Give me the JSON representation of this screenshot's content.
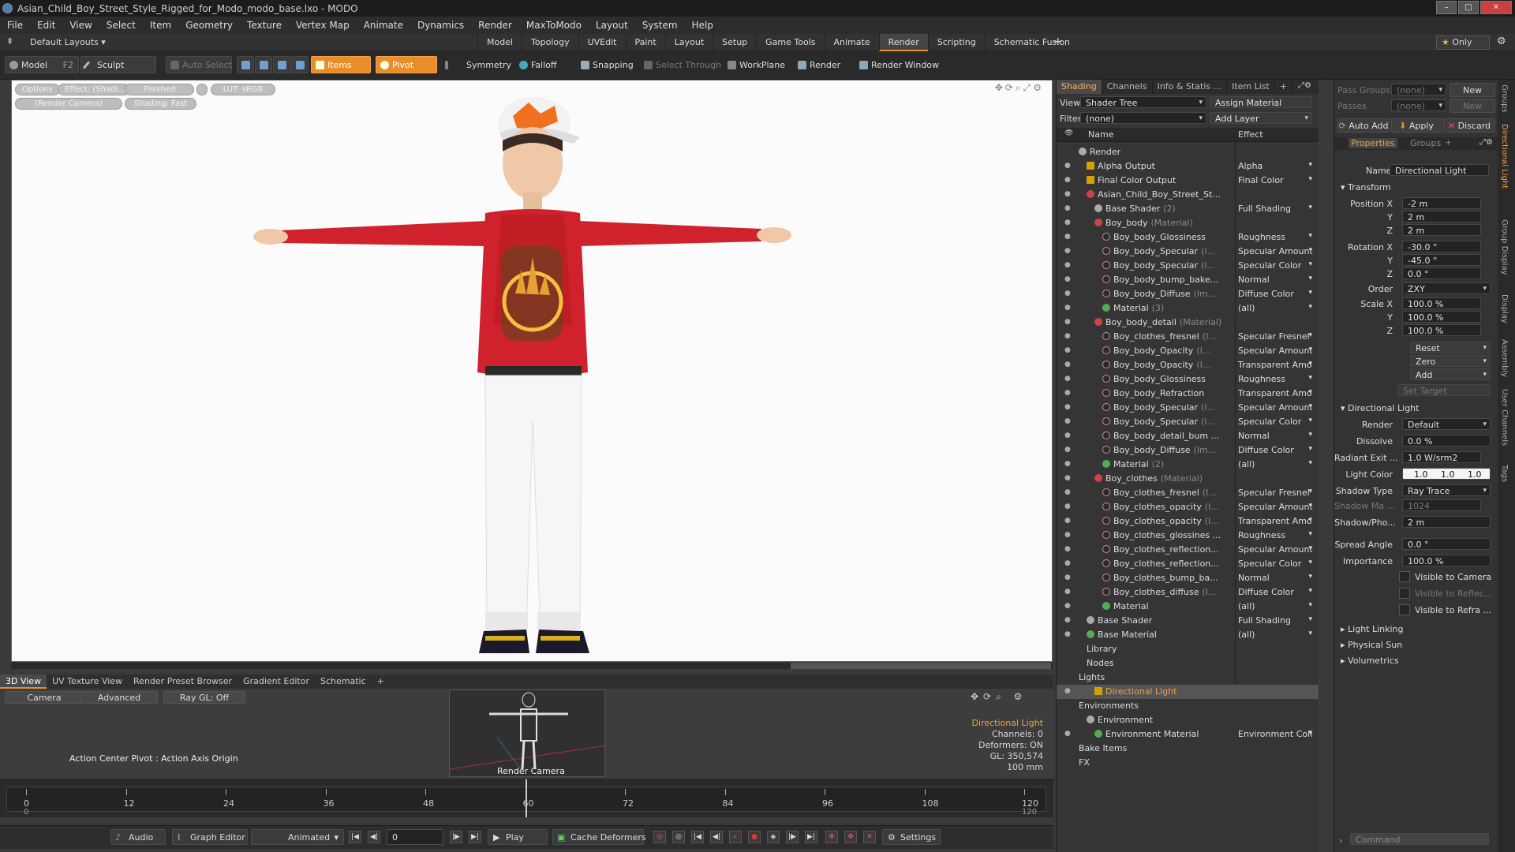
{
  "window": {
    "title": "Asian_Child_Boy_Street_Style_Rigged_for_Modo_modo_base.lxo - MODO"
  },
  "menu": [
    "File",
    "Edit",
    "View",
    "Select",
    "Item",
    "Geometry",
    "Texture",
    "Vertex Map",
    "Animate",
    "Dynamics",
    "Render",
    "MaxToModo",
    "Layout",
    "System",
    "Help"
  ],
  "layout": {
    "preset": "Default Layouts ▾",
    "tabs": [
      "Model",
      "Topology",
      "UVEdit",
      "Paint",
      "Layout",
      "Setup",
      "Game Tools",
      "Animate",
      "Render",
      "Scripting",
      "Schematic Fusion"
    ],
    "active_tab": "Render",
    "add": "+",
    "only": "Only"
  },
  "toolbar": {
    "model": "Model",
    "f2": "F2",
    "sculpt": "Sculpt",
    "auto_select": "Auto Select",
    "items": "Items",
    "pivot": "Pivot",
    "symmetry": "Symmetry",
    "falloff": "Falloff",
    "snapping": "Snapping",
    "select_through": "Select Through",
    "workplane": "WorkPlane",
    "render": "Render",
    "render_window": "Render Window"
  },
  "viewport": {
    "options": "Options",
    "effect": "Effect: (Shadi...",
    "finished": "Finished",
    "lut": "LUT: sRGB",
    "camera": "(Render Camera)",
    "shading": "Shading: Fast"
  },
  "bottom": {
    "tabs": [
      "3D View",
      "UV Texture View",
      "Render Preset Browser",
      "Gradient Editor",
      "Schematic"
    ],
    "active_tab": "3D View",
    "add": "+",
    "camera": "Camera",
    "advanced": "Advanced",
    "raygl": "Ray GL: Off",
    "action_center": "Action Center Pivot : Action Axis Origin",
    "render_camera": "Render Camera",
    "info": [
      "Directional Light",
      "Channels: 0",
      "Deformers: ON",
      "GL: 350,574",
      "100 mm"
    ]
  },
  "timeline": {
    "ticks": [
      "0",
      "12",
      "24",
      "36",
      "48",
      "60",
      "72",
      "84",
      "96",
      "108",
      "120"
    ],
    "sub_ticks": [
      "0",
      "120"
    ]
  },
  "transport": {
    "audio": "Audio",
    "graph_editor": "Graph Editor",
    "animated": "Animated",
    "frame": "0",
    "play": "Play",
    "cache_deformers": "Cache Deformers",
    "settings": "Settings"
  },
  "shading": {
    "tabs": [
      "Shading",
      "Channels",
      "Info & Statis ...",
      "Item List",
      "+"
    ],
    "active_tab": "Shading",
    "view_label": "View",
    "view_value": "Shader Tree",
    "assign": "Assign Material",
    "filter_label": "Filter",
    "filter_value": "(none)",
    "add_layer": "Add Layer",
    "col_name": "Name",
    "col_effect": "Effect",
    "rows": [
      {
        "name": "Render",
        "effect": "",
        "indent": 0,
        "type": "shader",
        "eye": false
      },
      {
        "name": "Alpha Output",
        "effect": "Alpha",
        "indent": 1,
        "type": "out",
        "eye": true
      },
      {
        "name": "Final Color Output",
        "effect": "Final Color",
        "indent": 1,
        "type": "out",
        "eye": true
      },
      {
        "name": "Asian_Child_Boy_Street_St...",
        "effect": "",
        "indent": 1,
        "type": "mat",
        "eye": true
      },
      {
        "name": "Base Shader",
        "sub": "(2)",
        "effect": "Full Shading",
        "indent": 2,
        "type": "shader",
        "eye": true
      },
      {
        "name": "Boy_body",
        "sub": "(Material)",
        "effect": "",
        "indent": 2,
        "type": "mat",
        "eye": true
      },
      {
        "name": "Boy_body_Glossiness",
        "effect": "Roughness",
        "indent": 3,
        "type": "tex",
        "eye": true
      },
      {
        "name": "Boy_body_Specular",
        "sub": "(I...",
        "effect": "Specular Amount",
        "indent": 3,
        "type": "tex",
        "eye": true
      },
      {
        "name": "Boy_body_Specular",
        "sub": "(I...",
        "effect": "Specular Color",
        "indent": 3,
        "type": "tex",
        "eye": true
      },
      {
        "name": "Boy_body_bump_bake...",
        "effect": "Normal",
        "indent": 3,
        "type": "tex",
        "eye": true
      },
      {
        "name": "Boy_body_Diffuse",
        "sub": "(Im...",
        "effect": "Diffuse Color",
        "indent": 3,
        "type": "tex",
        "eye": true
      },
      {
        "name": "Material",
        "sub": "(3)",
        "effect": "(all)",
        "indent": 3,
        "type": "grn",
        "eye": true
      },
      {
        "name": "Boy_body_detail",
        "sub": "(Material)",
        "effect": "",
        "indent": 2,
        "type": "mat",
        "eye": true
      },
      {
        "name": "Boy_clothes_fresnel",
        "sub": "(I...",
        "effect": "Specular Fresnel",
        "indent": 3,
        "type": "tex",
        "eye": true
      },
      {
        "name": "Boy_body_Opacity",
        "sub": "(I...",
        "effect": "Specular Amount",
        "indent": 3,
        "type": "tex",
        "eye": true
      },
      {
        "name": "Boy_body_Opacity",
        "sub": "(I...",
        "effect": "Transparent Amo ...",
        "indent": 3,
        "type": "tex",
        "eye": true
      },
      {
        "name": "Boy_body_Glossiness",
        "effect": "Roughness",
        "indent": 3,
        "type": "tex",
        "eye": true
      },
      {
        "name": "Boy_body_Refraction",
        "effect": "Transparent Amo ...",
        "indent": 3,
        "type": "tex",
        "eye": true
      },
      {
        "name": "Boy_body_Specular",
        "sub": "(I...",
        "effect": "Specular Amount",
        "indent": 3,
        "type": "tex",
        "eye": true
      },
      {
        "name": "Boy_body_Specular",
        "sub": "(I...",
        "effect": "Specular Color",
        "indent": 3,
        "type": "tex",
        "eye": true
      },
      {
        "name": "Boy_body_detail_bum ...",
        "effect": "Normal",
        "indent": 3,
        "type": "tex",
        "eye": true
      },
      {
        "name": "Boy_body_Diffuse",
        "sub": "(Im...",
        "effect": "Diffuse Color",
        "indent": 3,
        "type": "tex",
        "eye": true
      },
      {
        "name": "Material",
        "sub": "(2)",
        "effect": "(all)",
        "indent": 3,
        "type": "grn",
        "eye": true
      },
      {
        "name": "Boy_clothes",
        "sub": "(Material)",
        "effect": "",
        "indent": 2,
        "type": "mat",
        "eye": true
      },
      {
        "name": "Boy_clothes_fresnel",
        "sub": "(I...",
        "effect": "Specular Fresnel",
        "indent": 3,
        "type": "tex",
        "eye": true
      },
      {
        "name": "Boy_clothes_opacity",
        "sub": "(I...",
        "effect": "Specular Amount",
        "indent": 3,
        "type": "tex",
        "eye": true
      },
      {
        "name": "Boy_clothes_opacity",
        "sub": "(I...",
        "effect": "Transparent Amo ...",
        "indent": 3,
        "type": "tex",
        "eye": true
      },
      {
        "name": "Boy_clothes_glossines ...",
        "effect": "Roughness",
        "indent": 3,
        "type": "tex",
        "eye": true
      },
      {
        "name": "Boy_clothes_reflection...",
        "effect": "Specular Amount",
        "indent": 3,
        "type": "tex",
        "eye": true
      },
      {
        "name": "Boy_clothes_reflection...",
        "effect": "Specular Color",
        "indent": 3,
        "type": "tex",
        "eye": true
      },
      {
        "name": "Boy_clothes_bump_ba...",
        "effect": "Normal",
        "indent": 3,
        "type": "tex",
        "eye": true
      },
      {
        "name": "Boy_clothes_diffuse",
        "sub": "(I...",
        "effect": "Diffuse Color",
        "indent": 3,
        "type": "tex",
        "eye": true
      },
      {
        "name": "Material",
        "effect": "(all)",
        "indent": 3,
        "type": "grn",
        "eye": true
      },
      {
        "name": "Base Shader",
        "effect": "Full Shading",
        "indent": 1,
        "type": "shader",
        "eye": true
      },
      {
        "name": "Base Material",
        "effect": "(all)",
        "indent": 1,
        "type": "grn",
        "eye": true
      },
      {
        "name": "Library",
        "effect": "",
        "indent": 1,
        "type": "none",
        "eye": false
      },
      {
        "name": "Nodes",
        "effect": "",
        "indent": 1,
        "type": "none",
        "eye": false
      },
      {
        "name": "Lights",
        "effect": "",
        "indent": 0,
        "type": "none",
        "eye": false
      },
      {
        "name": "Directional Light",
        "effect": "",
        "indent": 2,
        "type": "out",
        "eye": true,
        "selected": true
      },
      {
        "name": "Environments",
        "effect": "",
        "indent": 0,
        "type": "none",
        "eye": false
      },
      {
        "name": "Environment",
        "effect": "",
        "indent": 1,
        "type": "shader",
        "eye": false
      },
      {
        "name": "Environment Material",
        "effect": "Environment Color",
        "indent": 2,
        "type": "grn",
        "eye": true
      },
      {
        "name": "Bake Items",
        "effect": "",
        "indent": 0,
        "type": "none",
        "eye": false
      },
      {
        "name": "FX",
        "effect": "",
        "indent": 0,
        "type": "none",
        "eye": false
      }
    ]
  },
  "props": {
    "pass_groups": "Pass Groups",
    "pass_none": "(none)",
    "new": "New",
    "passes": "Passes",
    "passes_none": "(none)",
    "new2": "New",
    "auto_add": "Auto Add",
    "apply": "Apply",
    "discard": "Discard",
    "tab_props": "Properties",
    "tab_groups": "Groups",
    "plus": "+",
    "name_label": "Name",
    "name_value": "Directional Light",
    "transform": "Transform",
    "pos_x_label": "Position X",
    "pos_x": "-2 m",
    "pos_y": "2 m",
    "pos_z": "2 m",
    "rot_x_label": "Rotation X",
    "rot_x": "-30.0 °",
    "rot_y": "-45.0 °",
    "rot_z": "0.0 °",
    "order_label": "Order",
    "order": "ZXY",
    "scale_x_label": "Scale X",
    "scale_x": "100.0 %",
    "scale_y": "100.0 %",
    "scale_z": "100.0 %",
    "y": "Y",
    "z": "Z",
    "reset": "Reset",
    "zero": "Zero",
    "add": "Add",
    "set_target": "Set Target",
    "dl_section": "Directional Light",
    "render_label": "Render",
    "render_value": "Default",
    "dissolve_label": "Dissolve",
    "dissolve": "0.0 %",
    "radiant_label": "Radiant Exit ...",
    "radiant": "1.0 W/srm2",
    "color_label": "Light Color",
    "color_r": "1.0",
    "color_g": "1.0",
    "color_b": "1.0",
    "shadow_type_label": "Shadow Type",
    "shadow_type": "Ray Trace",
    "shadow_map_label": "Shadow Ma ...",
    "shadow_map": "1024",
    "shadow_pho_label": "Shadow/Pho...",
    "shadow_pho": "2 m",
    "spread_label": "Spread Angle",
    "spread": "0.0 °",
    "importance_label": "Importance",
    "importance": "100.0 %",
    "vis_camera": "Visible to Camera",
    "vis_reflect": "Visible to Reflec...",
    "vis_refract": "Visible to Refra ...",
    "light_linking": "Light Linking",
    "physical_sun": "Physical Sun",
    "volumetrics": "Volumetrics",
    "command": "Command"
  },
  "side_tabs": [
    "Groups",
    "Directional Light",
    "Group Display",
    "Display",
    "Assembly",
    "User Channels",
    "Tags"
  ],
  "side_active": "Directional Light",
  "colors": {
    "accent": "#e88d2a",
    "selected_text": "#f0a040"
  }
}
